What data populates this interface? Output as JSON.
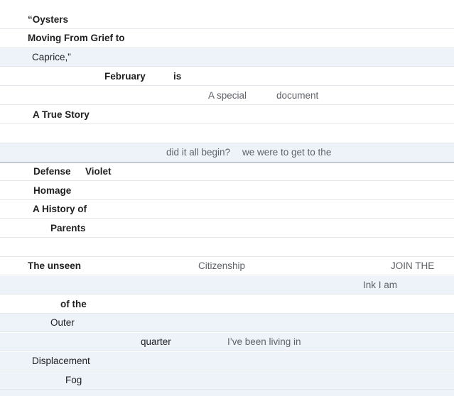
{
  "rows": [
    {
      "cells": [
        "“Oysters"
      ]
    },
    {
      "cells": [
        "Moving From Grief to"
      ]
    },
    {
      "cells": [
        "Caprice,”"
      ]
    },
    {
      "cells": [
        "February",
        "is"
      ]
    },
    {
      "cells": [
        "A special",
        "document"
      ]
    },
    {
      "cells": [
        "A True Story"
      ]
    },
    {
      "cells": []
    },
    {
      "cells": [
        "did it all begin?",
        "we were to get to the"
      ]
    },
    {
      "cells": [
        "Defense",
        "Violet"
      ]
    },
    {
      "cells": [
        "Homage"
      ]
    },
    {
      "cells": [
        "A History of"
      ]
    },
    {
      "cells": [
        "Parents"
      ]
    },
    {
      "cells": []
    },
    {
      "cells": [
        "The unseen",
        "Citizenship",
        "JOIN THE"
      ]
    },
    {
      "cells": [
        "Ink I am"
      ]
    },
    {
      "cells": [
        "of the"
      ]
    },
    {
      "cells": [
        "Outer"
      ]
    },
    {
      "cells": [
        "quarter",
        "I’ve been living in"
      ]
    },
    {
      "cells": [
        "Displacement"
      ]
    },
    {
      "cells": [
        "Fog"
      ]
    },
    {
      "cells": []
    }
  ]
}
